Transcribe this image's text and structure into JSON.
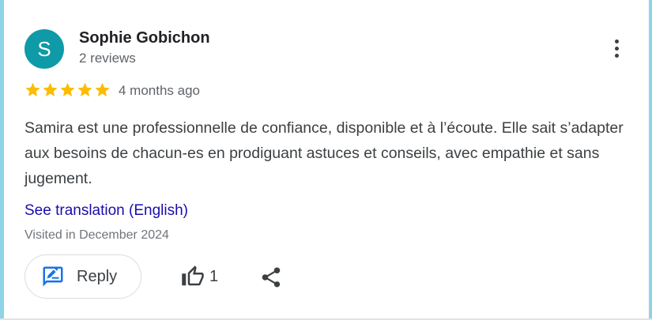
{
  "review": {
    "avatar_letter": "S",
    "author": "Sophie Gobichon",
    "author_reviews": "2 reviews",
    "rating": 5,
    "max_rating": 5,
    "time_ago": "4 months ago",
    "text": "Samira est une professionnelle de confiance, disponible et à l’écoute. Elle sait s’adapter aux besoins de chacun-es en prodiguant astuces et conseils, avec empathie et sans jugement.",
    "translate_link": "See translation (English)",
    "visited": "Visited in December 2024"
  },
  "actions": {
    "reply_label": "Reply",
    "like_count": "1"
  },
  "icons": {
    "more": "more-vert-icon",
    "star": "star-icon",
    "reply": "reply-icon",
    "like": "thumb-up-icon",
    "share": "share-icon"
  },
  "colors": {
    "avatar_bg": "#0f9aa7",
    "star": "#fbbc04",
    "link": "#1a0dab",
    "reply_icon": "#1a73e8"
  }
}
